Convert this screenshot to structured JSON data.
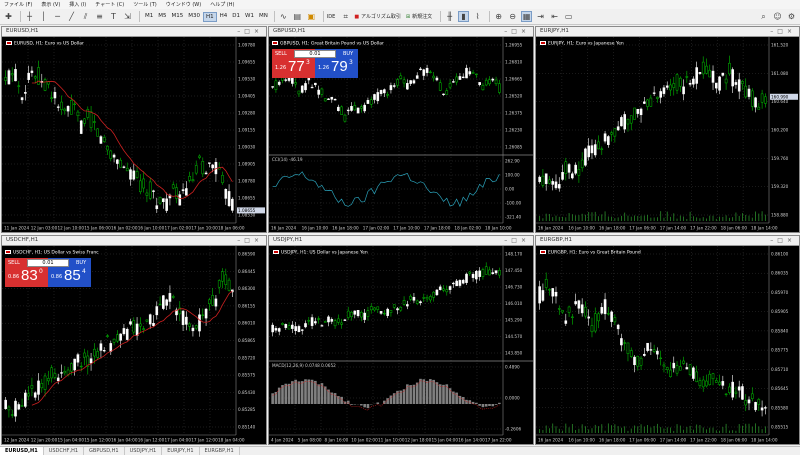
{
  "menu": [
    "ファイル (F)",
    "表示 (V)",
    "挿入 (I)",
    "チャート (C)",
    "ツール (T)",
    "ウインドウ (W)",
    "ヘルプ (H)"
  ],
  "toolbar": {
    "timeframes": [
      "M1",
      "M5",
      "M15",
      "M30",
      "H1",
      "H4",
      "D1",
      "W1",
      "MN"
    ],
    "active_timeframe": "H1",
    "ide_label": "IDE",
    "algo_label": "アルゴリズム取引",
    "new_order_label": "新規注文"
  },
  "windows": [
    {
      "id": "eurusd",
      "title": "EURUSD,H1",
      "label": "EURUSD, H1:  Euro vs US Dollar",
      "price_labels": [
        "1.09780",
        "1.09655",
        "1.09530",
        "1.09405",
        "1.09280",
        "1.09155",
        "1.09030",
        "1.08905",
        "1.08780",
        "1.08655",
        "1.08530"
      ],
      "current_price": "1.08655",
      "time_labels": [
        "11 Jan 2024",
        "12 Jan 03:00",
        "12 Jan 10:00",
        "15 Jan 06:00",
        "16 Jan 02:00",
        "16 Jan 10:00",
        "17 Jan 02:00",
        "17 Jan 10:00",
        "18 Jan 06:00"
      ]
    },
    {
      "id": "gbpusd",
      "title": "GBPUSD,H1",
      "label": "GBPUSD, H1:  Great Britain Pound vs US Dollar",
      "price_labels": [
        "1.26955",
        "1.26810",
        "1.26665",
        "1.26520",
        "1.26375",
        "1.26230",
        "1.26085"
      ],
      "indicator_label": "CCI(14) -46.19",
      "indicator_levels": [
        "262.90",
        "100.00",
        "0.00",
        "-100.00",
        "-321.40"
      ],
      "trade": {
        "sell": "SELL",
        "buy": "BUY",
        "volume": "0.01",
        "sell_small": "1.26",
        "sell_big": "77",
        "sell_sup": "3",
        "buy_small": "1.26",
        "buy_big": "79",
        "buy_sup": "3"
      },
      "time_labels": [
        "16 Jan 2024",
        "16 Jan 10:00",
        "16 Jan 18:00",
        "17 Jan 02:00",
        "17 Jan 10:00",
        "17 Jan 18:00",
        "18 Jan 02:00",
        "18 Jan 10:00"
      ]
    },
    {
      "id": "eurjpy",
      "title": "EURJPY,H1",
      "label": "EURJPY, H1:  Euro vs Japanese Yen",
      "price_labels": [
        "161.520",
        "161.080",
        "160.640",
        "160.200",
        "159.760",
        "159.320",
        "158.880"
      ],
      "current_price": "160.990",
      "time_labels": [
        "16 Jan 2024",
        "16 Jan 10:00",
        "16 Jan 18:00",
        "17 Jan 06:00",
        "17 Jan 14:00",
        "17 Jan 22:00",
        "18 Jan 06:00",
        "18 Jan 14:00"
      ]
    },
    {
      "id": "usdchf",
      "title": "USDCHF,H1",
      "label": "USDCHF, H1:  US Dollar vs Swiss Franc",
      "price_labels": [
        "0.86590",
        "0.86445",
        "0.86300",
        "0.86155",
        "0.86010",
        "0.85865",
        "0.85720",
        "0.85575",
        "0.85430",
        "0.85285",
        "0.85140"
      ],
      "trade": {
        "sell": "SELL",
        "buy": "BUY",
        "volume": "0.01",
        "sell_small": "0.86",
        "sell_big": "83",
        "sell_sup": "0",
        "buy_small": "0.86",
        "buy_big": "85",
        "buy_sup": "4"
      },
      "time_labels": [
        "12 Jan 2024",
        "12 Jan 20:00",
        "15 Jan 04:00",
        "15 Jan 12:00",
        "16 Jan 04:00",
        "16 Jan 12:00",
        "17 Jan 04:00",
        "17 Jan 12:00",
        "18 Jan 04:00"
      ]
    },
    {
      "id": "usdjpy",
      "title": "USDJPY,H1",
      "label": "USDJPY, H1:  US Dollar vs Japanese Yen",
      "price_labels": [
        "148.170",
        "147.450",
        "146.730",
        "146.010",
        "145.290",
        "144.570",
        "143.850"
      ],
      "indicator_label": "MACD(12,26,9) 0.0748 0.0652",
      "indicator_levels": [
        "0.4890",
        "0.0000",
        "-0.2606"
      ],
      "time_labels": [
        "4 Jan 2024",
        "5 Jan 08:00",
        "8 Jan 16:00",
        "10 Jan 02:00",
        "11 Jan 10:00",
        "12 Jan 18:00",
        "15 Jan 04:00",
        "16 Jan 14:00",
        "17 Jan 22:00"
      ]
    },
    {
      "id": "eurgbp",
      "title": "EURGBP,H1",
      "label": "EURGBP, H1:  Euro vs Great Britain Pound",
      "price_labels": [
        "0.86100",
        "0.86035",
        "0.85970",
        "0.85905",
        "0.85840",
        "0.85775",
        "0.85710",
        "0.85645",
        "0.85580",
        "0.85515"
      ],
      "time_labels": [
        "16 Jan 2024",
        "16 Jan 10:00",
        "16 Jan 18:00",
        "17 Jan 06:00",
        "17 Jan 14:00",
        "17 Jan 22:00",
        "18 Jan 06:00",
        "18 Jan 14:00"
      ]
    }
  ],
  "tabs": [
    "EURUSD,H1",
    "USDCHF,H1",
    "GBPUSD,H1",
    "USDJPY,H1",
    "EURJPY,H1",
    "EURGBP,H1"
  ],
  "active_tab": "EURUSD,H1",
  "colors": {
    "bull": "#00c000",
    "bear": "#ffffff",
    "ma": "#cc2020",
    "cci": "#2aa0b8",
    "macd": "#808080",
    "signal": "#cc2020",
    "grid": "#444444"
  }
}
